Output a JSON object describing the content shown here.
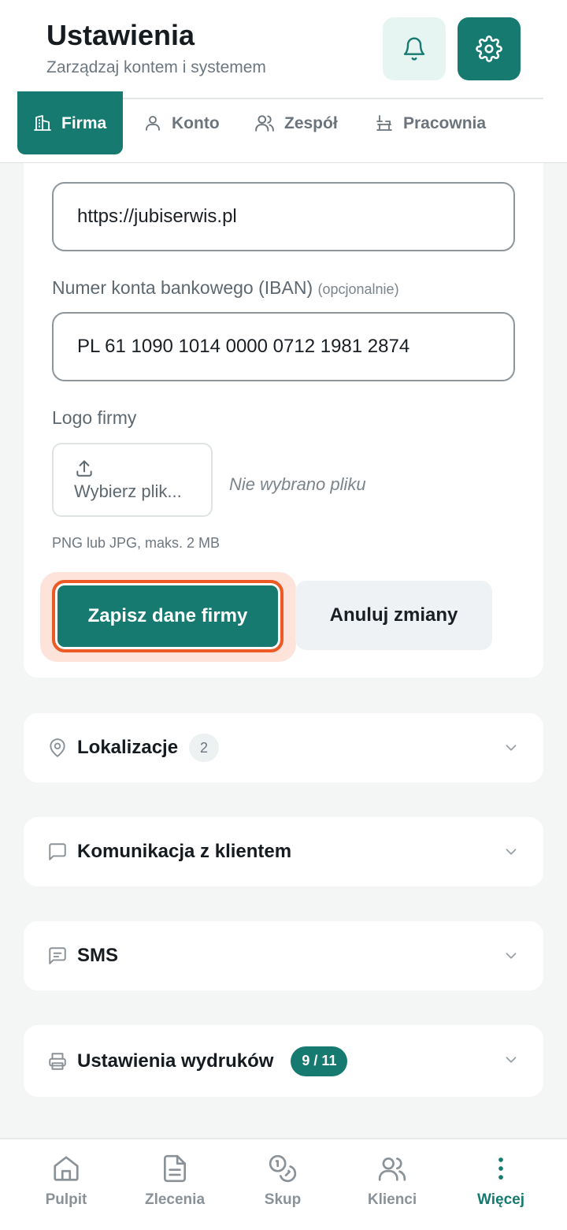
{
  "header": {
    "title": "Ustawienia",
    "subtitle": "Zarządzaj kontem i systemem",
    "bell_icon": "bell-icon",
    "settings_icon": "gear-icon"
  },
  "tabs": [
    {
      "label": "Firma",
      "icon": "building-icon",
      "active": true
    },
    {
      "label": "Konto",
      "icon": "user-icon",
      "active": false
    },
    {
      "label": "Zespół",
      "icon": "users-icon",
      "active": false
    },
    {
      "label": "Pracownia",
      "icon": "workbench-icon",
      "active": false
    }
  ],
  "form": {
    "website_value": "https://jubiserwis.pl",
    "iban_label": "Numer konta bankowego (IBAN)",
    "iban_optional": "(opcjonalnie)",
    "iban_value": "PL 61 1090 1014 0000 0712 1981 2874",
    "logo_label": "Logo firmy",
    "file_button": "Wybierz plik...",
    "no_file": "Nie wybrano pliku",
    "file_hint": "PNG lub JPG, maks. 2 MB",
    "save_label": "Zapisz dane firmy",
    "cancel_label": "Anuluj zmiany"
  },
  "sections": [
    {
      "title": "Lokalizacje",
      "icon": "map-pin-icon",
      "badge": "2"
    },
    {
      "title": "Komunikacja z klientem",
      "icon": "message-icon",
      "badge": ""
    },
    {
      "title": "SMS",
      "icon": "sms-icon",
      "badge": ""
    },
    {
      "title": "Ustawienia wydruków",
      "icon": "printer-icon",
      "badge": "9 / 11"
    }
  ],
  "bottom_nav": [
    {
      "label": "Pulpit",
      "icon": "home-icon",
      "active": false
    },
    {
      "label": "Zlecenia",
      "icon": "document-icon",
      "active": false
    },
    {
      "label": "Skup",
      "icon": "coins-icon",
      "active": false
    },
    {
      "label": "Klienci",
      "icon": "users-icon",
      "active": false
    },
    {
      "label": "Więcej",
      "icon": "more-vertical-icon",
      "active": true
    }
  ],
  "colors": {
    "accent": "#167a70",
    "highlight": "#ee5a24"
  }
}
